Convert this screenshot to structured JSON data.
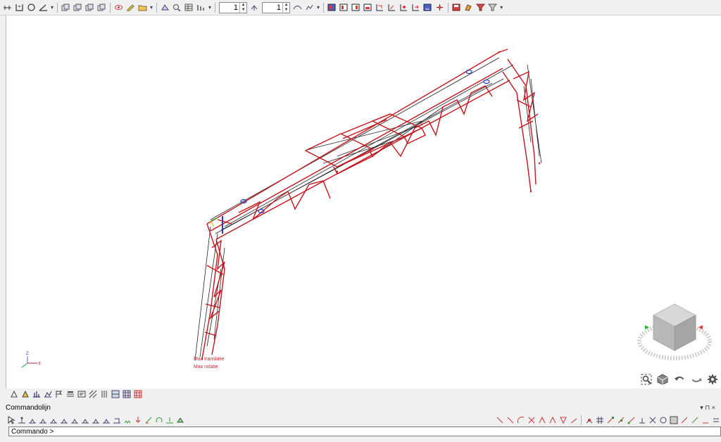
{
  "toolbar": {
    "spin1_value": "1",
    "spin2_value": "1",
    "icons_group1": [
      "grid-icon",
      "bracket-icon",
      "circle-icon",
      "angle-icon"
    ],
    "icons_group2": [
      "copy-icon",
      "copy2-icon",
      "copy3-icon",
      "copy4-icon"
    ],
    "icons_group3": [
      "eye-icon",
      "pencil-icon",
      "folder-icon"
    ],
    "icons_group4": [
      "shape-icon",
      "zoom-icon",
      "table-icon",
      "bar-icon"
    ],
    "icons_group5": [
      "view-front-icon",
      "view-side-icon",
      "view-top-icon",
      "view-iso-icon",
      "view-a-icon",
      "view-b-icon",
      "view-c-icon",
      "view-d-icon",
      "view-e-icon",
      "view-f-icon",
      "move-icon"
    ],
    "icons_group6": [
      "save-icon",
      "paint-icon",
      "filter-icon",
      "filter2-icon"
    ]
  },
  "model": {
    "annotation_1": "Max translatie",
    "annotation_2": "Max rotatie",
    "axis_z": "Z",
    "axis_x": "X",
    "frame_color": "#c4151c",
    "member_color": "#222222",
    "support_color": "#1f3fbf"
  },
  "commandline": {
    "title": "Commandolijn",
    "prompt": "Commando >",
    "pin_label": "▾ ⊓ ×"
  }
}
